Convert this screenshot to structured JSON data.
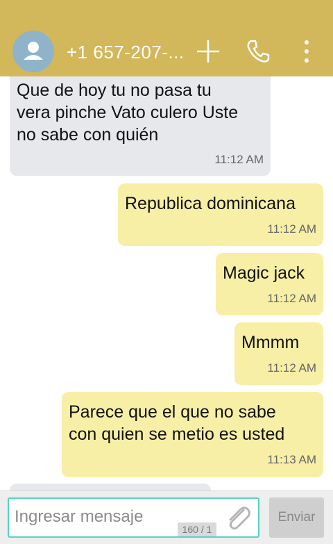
{
  "header": {
    "contact_name": "+1 657-207-...",
    "avatar_icon": "person-icon",
    "add_icon": "plus-icon",
    "call_icon": "phone-icon",
    "menu_icon": "more-vertical-icon",
    "color": "#d2b75b"
  },
  "messages": [
    {
      "direction": "in",
      "lines": [
        "Que de hoy tu no pasa tu",
        "vera pinche Vato culero Uste",
        "no sabe con quién"
      ],
      "time": "11:12 AM"
    },
    {
      "direction": "out",
      "lines": [
        "Republica dominicana"
      ],
      "time": "11:12 AM"
    },
    {
      "direction": "out",
      "lines": [
        "Magic jack"
      ],
      "time": "11:12 AM"
    },
    {
      "direction": "out",
      "lines": [
        "Mmmm"
      ],
      "time": "11:12 AM"
    },
    {
      "direction": "out",
      "lines": [
        "Parece que el que no sabe",
        "con quien se metio es usted"
      ],
      "time": "11:13 AM"
    }
  ],
  "composer": {
    "placeholder": "Ingresar mensaje",
    "counter": "160 / 1",
    "attach_icon": "paperclip-icon",
    "send_label": "Enviar"
  },
  "colors": {
    "incoming_bubble": "#e6e8ec",
    "outgoing_bubble": "#f7efa6",
    "input_border": "#5ad0c8"
  }
}
